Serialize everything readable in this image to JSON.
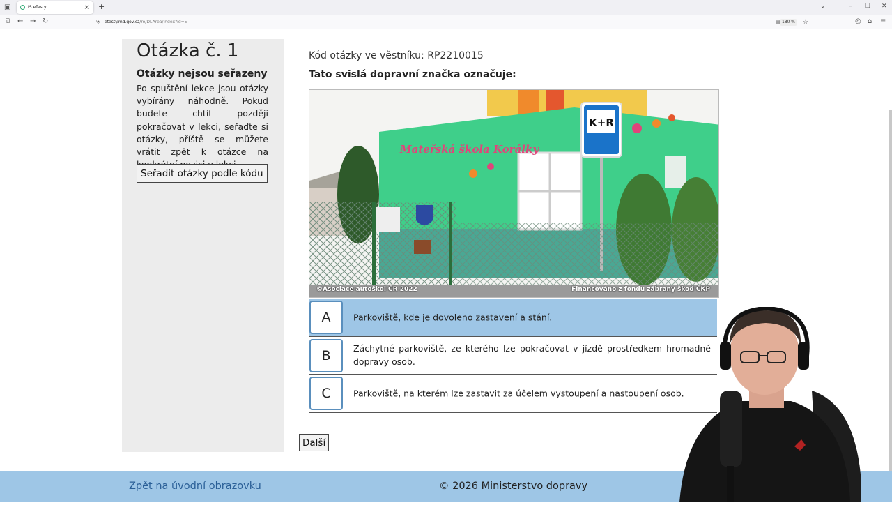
{
  "browser": {
    "tab_title": "IS eTesty",
    "url_host": "etesty.md.gov.cz",
    "url_path": "/ro/DI.Area/Index?id=5",
    "zoom": "180 %"
  },
  "sidebar": {
    "title": "Otázka č. 1",
    "subtitle": "Otázky nejsou seřazeny",
    "description": "Po spuštění lekce jsou otázky vybírány náhodně. Pokud budete chtít později pokračovat v lekci, seřaďte si otázky, příště se můžete vrátit zpět k otázce na konkrétní pozici v lekci.",
    "sort_button": "Seřadit otázky podle kódu"
  },
  "question": {
    "code_label": "Kód otázky ve věstníku: RP2210015",
    "text": "Tato svislá dopravní značka označuje:",
    "image": {
      "sign_text": "K+R",
      "building_text": "Mateřská škola Korálky",
      "credit_left": "©Asociace autoškol ČR 2022",
      "credit_right": "Financováno z fondu zábrany škod ČKP"
    },
    "answers": [
      {
        "letter": "A",
        "text": "Parkoviště, kde je dovoleno zastavení a stání.",
        "selected": true
      },
      {
        "letter": "B",
        "text": "Záchytné parkoviště, ze kterého lze pokračovat v jízdě prostředkem hromadné dopravy osob.",
        "selected": false
      },
      {
        "letter": "C",
        "text": "Parkoviště, na kterém lze zastavit za účelem vystoupení a nastoupení osob.",
        "selected": false
      }
    ],
    "next_button": "Další"
  },
  "footer": {
    "back_link": "Zpět na úvodní obrazovku",
    "copyright": "© 2026 Ministerstvo dopravy"
  },
  "colors": {
    "selected_answer": "#9ec6e6",
    "footer_bg": "#9ec6e6",
    "letter_border": "#5a8fbd",
    "link": "#2a5f97"
  }
}
